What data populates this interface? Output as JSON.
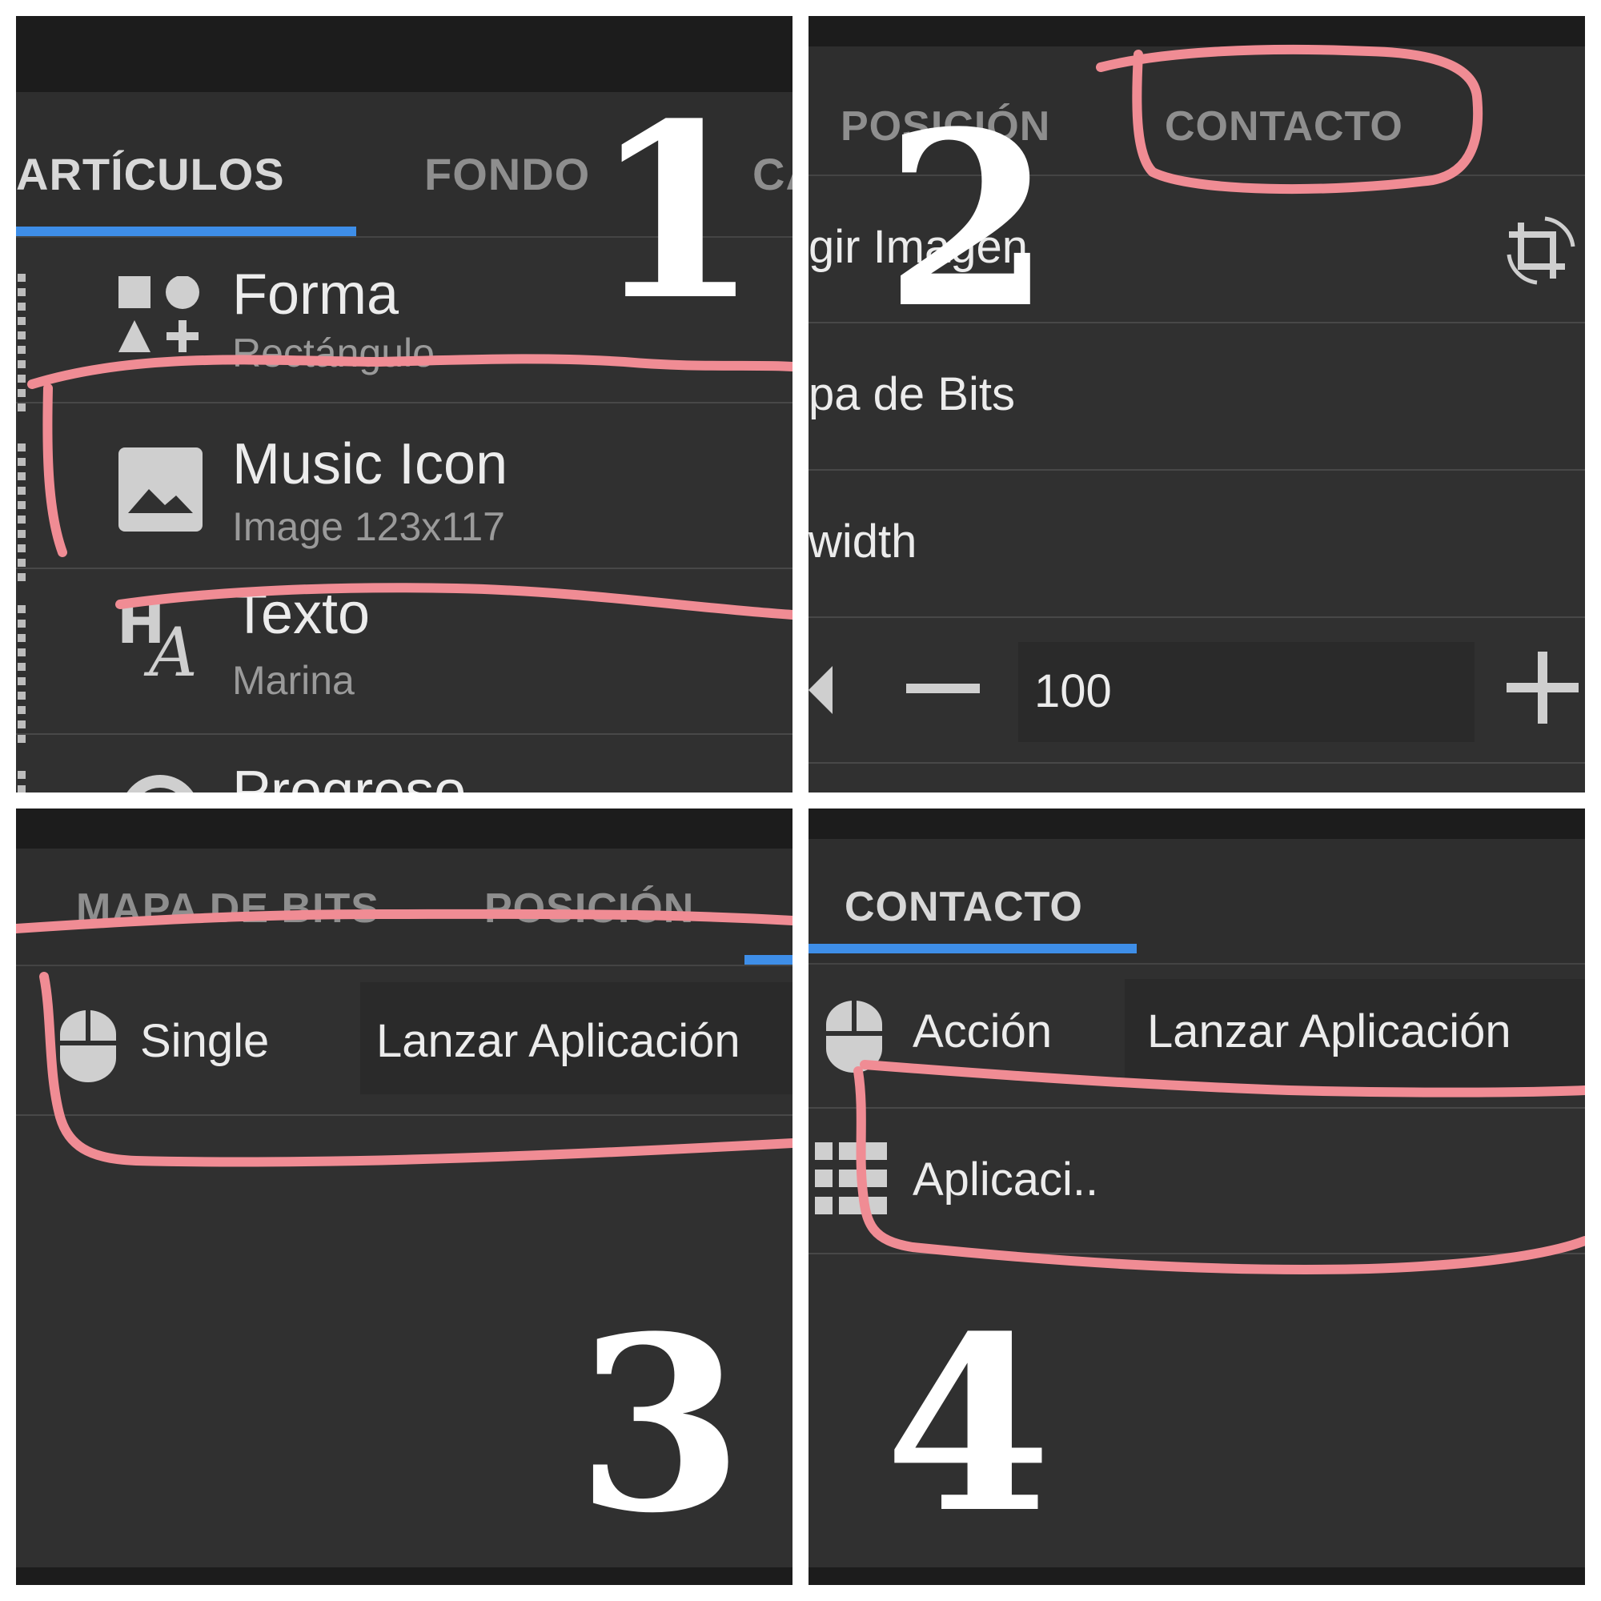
{
  "panel_numbers": [
    "1",
    "2",
    "3",
    "4"
  ],
  "panel1": {
    "tabs": [
      {
        "label": "ARTÍCULOS",
        "active": true
      },
      {
        "label": "FONDO",
        "active": false
      },
      {
        "label": "CA",
        "active": false
      }
    ],
    "items": [
      {
        "title": "Forma",
        "subtitle": "Rectángulo",
        "icon": "shapes-icon"
      },
      {
        "title": "Music Icon",
        "subtitle": "Image 123x117",
        "icon": "image-icon"
      },
      {
        "title": "Texto",
        "subtitle": "Marina",
        "icon": "text-style-icon"
      },
      {
        "title": "Progreso",
        "subtitle": "",
        "icon": "progress-icon"
      }
    ]
  },
  "panel2": {
    "tabs": [
      {
        "label": "POSICIÓN",
        "active": false
      },
      {
        "label": "CONTACTO",
        "active": false
      }
    ],
    "rows": [
      {
        "label": "gir Imagen",
        "icon": "crop-rotate-icon"
      },
      {
        "label": "pa de Bits"
      },
      {
        "label": "width"
      }
    ],
    "stepper": {
      "value": "100",
      "minus": "−",
      "plus": "+"
    }
  },
  "panel3": {
    "tabs": [
      {
        "label": "MAPA DE BITS",
        "active": false
      },
      {
        "label": "POSICIÓN",
        "active": false
      }
    ],
    "row": {
      "label": "Single",
      "value": "Lanzar Aplicación",
      "icon": "mouse-icon"
    }
  },
  "panel4": {
    "tabs": [
      {
        "label": "CONTACTO",
        "active": true
      }
    ],
    "rows": [
      {
        "label": "Acción",
        "value": "Lanzar Aplicación",
        "icon": "mouse-icon"
      },
      {
        "label": "Aplicaci..",
        "icon": "app-list-icon"
      }
    ]
  },
  "colors": {
    "panel_bg": "#303030",
    "status_bar": "#1c1c1c",
    "accent_blue": "#3e8ee8",
    "annotation_pink": "#f08c94",
    "text_primary": "#ececec",
    "text_secondary": "#9a9a9a"
  }
}
